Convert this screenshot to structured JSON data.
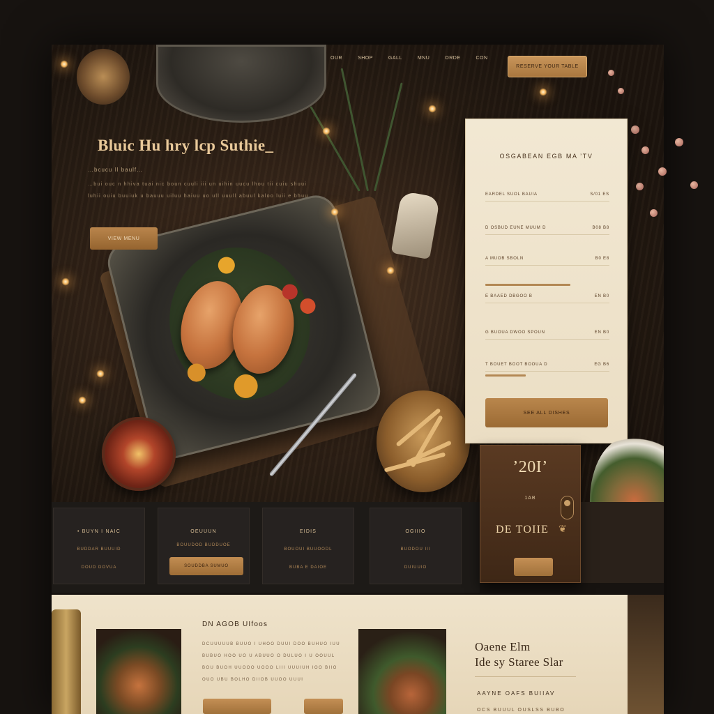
{
  "nav": {
    "links": [
      "OUR",
      "SHOP",
      "GALL",
      "MNU",
      "ORDE",
      "CON"
    ],
    "cta_label": "RESERVE YOUR TABLE"
  },
  "hero": {
    "title": "Bluic Hu hry lcp Suthie_",
    "subtitle": "…bcucu Il baulf…",
    "body": "…bui ouc n hhiva tuai nic boun cuuli iii un uihin uucu lhou tii cuiu shuui luhii ouiu buuiuk u bauuu uiluu haiuu uo ull uuull abuul kaloo luii e bhuu",
    "cta_label": "VIEW MENU"
  },
  "form": {
    "title": "OSGABEAN EGB MA ’TV",
    "rows": [
      {
        "label": "EARDEL SUOL BAUIA",
        "value": "S/01 ES"
      },
      {
        "label": "D OSBUD EUNE MUUM D",
        "value": "B08 B8"
      },
      {
        "label": "A MUOB SBOLN",
        "value": "B0 E8"
      },
      {
        "label": "E BAAED DBGOO B",
        "value": "EN B0"
      },
      {
        "label": "G BUOUA DWOO SPOUN",
        "value": "EN B0"
      },
      {
        "label": "T BOUET BOOT BOOUA D",
        "value": "EG B6"
      }
    ],
    "submit_label": "SEE ALL DISHES"
  },
  "price_card": {
    "year": "’20I’",
    "sub": "1AB",
    "name": "DE TOIIE",
    "icon": "❦"
  },
  "tiles": [
    {
      "head": "• BUYN I NAIC",
      "lines": [
        "BUDDAR BUUUID",
        "DOUD DOVUA"
      ],
      "button": ""
    },
    {
      "head": "OEUUUN",
      "lines": [
        "BOUUDOD BUDDUOE"
      ],
      "button": "SOUDDBA SUMUO"
    },
    {
      "head": "EIDIS",
      "lines": [
        "BOUOUI BUUOODL",
        "BUBA E DAIOE"
      ],
      "button": ""
    },
    {
      "head": "OGIIIO",
      "lines": [
        "BUODOU III",
        "DUIUUIO"
      ],
      "button": ""
    }
  ],
  "bottom": {
    "heading": "DN AGOB UIfoos",
    "body": "DCUUUUUB BUUO I UHOO DUUI DOO BUHUO IUU BUBUO HOO UO U ABUUO O DULUO I U OOUUL BOU BUOH UUOOO UOOO LIII UUUIUH IOO BIIO OUO UBU BOLHO DIIOB UUOO UUUI",
    "quote_title_line1": "Oaene Elm",
    "quote_title_line2": "Ide sy Staree Slar",
    "quote_sub": "AAYNE OAFS BUIIAV",
    "quote_extra": "OCS BUUUL OUSLSS BUBO"
  },
  "colors": {
    "accent": "#b9864c",
    "cream": "#f2e8d3",
    "dark": "#1d1a17"
  }
}
